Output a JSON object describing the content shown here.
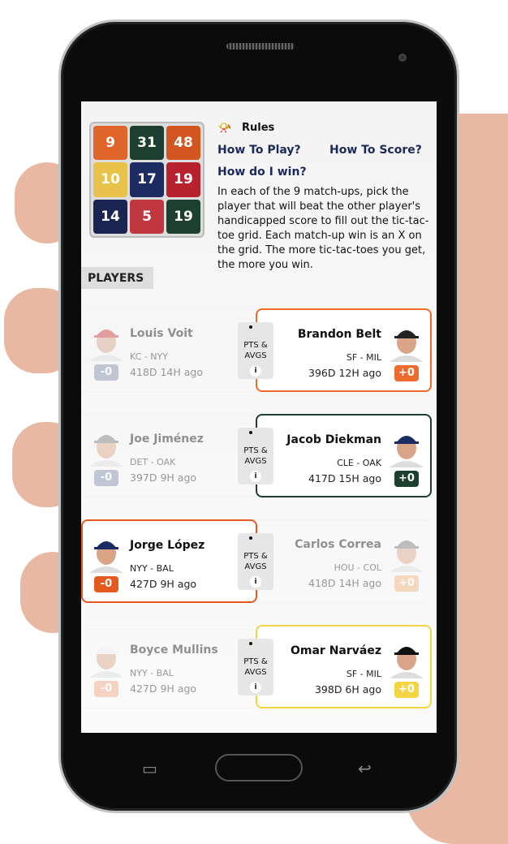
{
  "grid": [
    {
      "v": "9",
      "c": "#e0652b"
    },
    {
      "v": "31",
      "c": "#1d3f30"
    },
    {
      "v": "48",
      "c": "#d2561f"
    },
    {
      "v": "10",
      "c": "#e8c24a"
    },
    {
      "v": "17",
      "c": "#1c2c63"
    },
    {
      "v": "19",
      "c": "#b8212e"
    },
    {
      "v": "14",
      "c": "#1a2552"
    },
    {
      "v": "5",
      "c": "#c0383d"
    },
    {
      "v": "19",
      "c": "#1d3f30"
    }
  ],
  "rules": {
    "title": "Rules",
    "icon": "whistle-icon",
    "how_to_play": "How To Play?",
    "how_to_score": "How To Score?",
    "how_win": "How do I win?",
    "description": "In each of the 9 match-ups, pick the player that will beat the other player's handicapped score to fill out the tic-tac-toe grid. Each match-up win is an X on the grid. The more tic-tac-toes you get, the more you win."
  },
  "section": "PLAYERS",
  "center": {
    "line1": "PTS &",
    "line2": "AVGS",
    "info": "i"
  },
  "matchups": [
    {
      "selected": "right",
      "color": "#ee6b2d",
      "left": {
        "name": "Louis Voit",
        "teams": "KC - NYY",
        "time": "418D 14H ago",
        "badge": "-0",
        "badge_color": "#7e8aa8"
      },
      "right": {
        "name": "Brandon Belt",
        "teams": "SF - MIL",
        "time": "396D 12H ago",
        "badge": "+0",
        "badge_color": "#ee6b2d"
      }
    },
    {
      "selected": "right",
      "color": "#1d3f30",
      "left": {
        "name": "Joe Jiménez",
        "teams": "DET - OAK",
        "time": "397D 9H ago",
        "badge": "-0",
        "badge_color": "#7e8aa8"
      },
      "right": {
        "name": "Jacob Diekman",
        "teams": "CLE - OAK",
        "time": "417D 15H ago",
        "badge": "+0",
        "badge_color": "#1d3f30"
      }
    },
    {
      "selected": "left",
      "color": "#e45a1e",
      "left": {
        "name": "Jorge López",
        "teams": "NYY - BAL",
        "time": "427D 9H ago",
        "badge": "-0",
        "badge_color": "#e45a1e"
      },
      "right": {
        "name": "Carlos Correa",
        "teams": "HOU - COL",
        "time": "418D 14H ago",
        "badge": "+0",
        "badge_color": "#f0b07a"
      }
    },
    {
      "selected": "right",
      "color": "#f5d443",
      "left": {
        "name": "Boyce Mullins",
        "teams": "NYY - BAL",
        "time": "427D 9H ago",
        "badge": "-0",
        "badge_color": "#f0a57a"
      },
      "right": {
        "name": "Omar Narváez",
        "teams": "SF - MIL",
        "time": "398D 6H ago",
        "badge": "+0",
        "badge_color": "#f5d443"
      }
    }
  ]
}
